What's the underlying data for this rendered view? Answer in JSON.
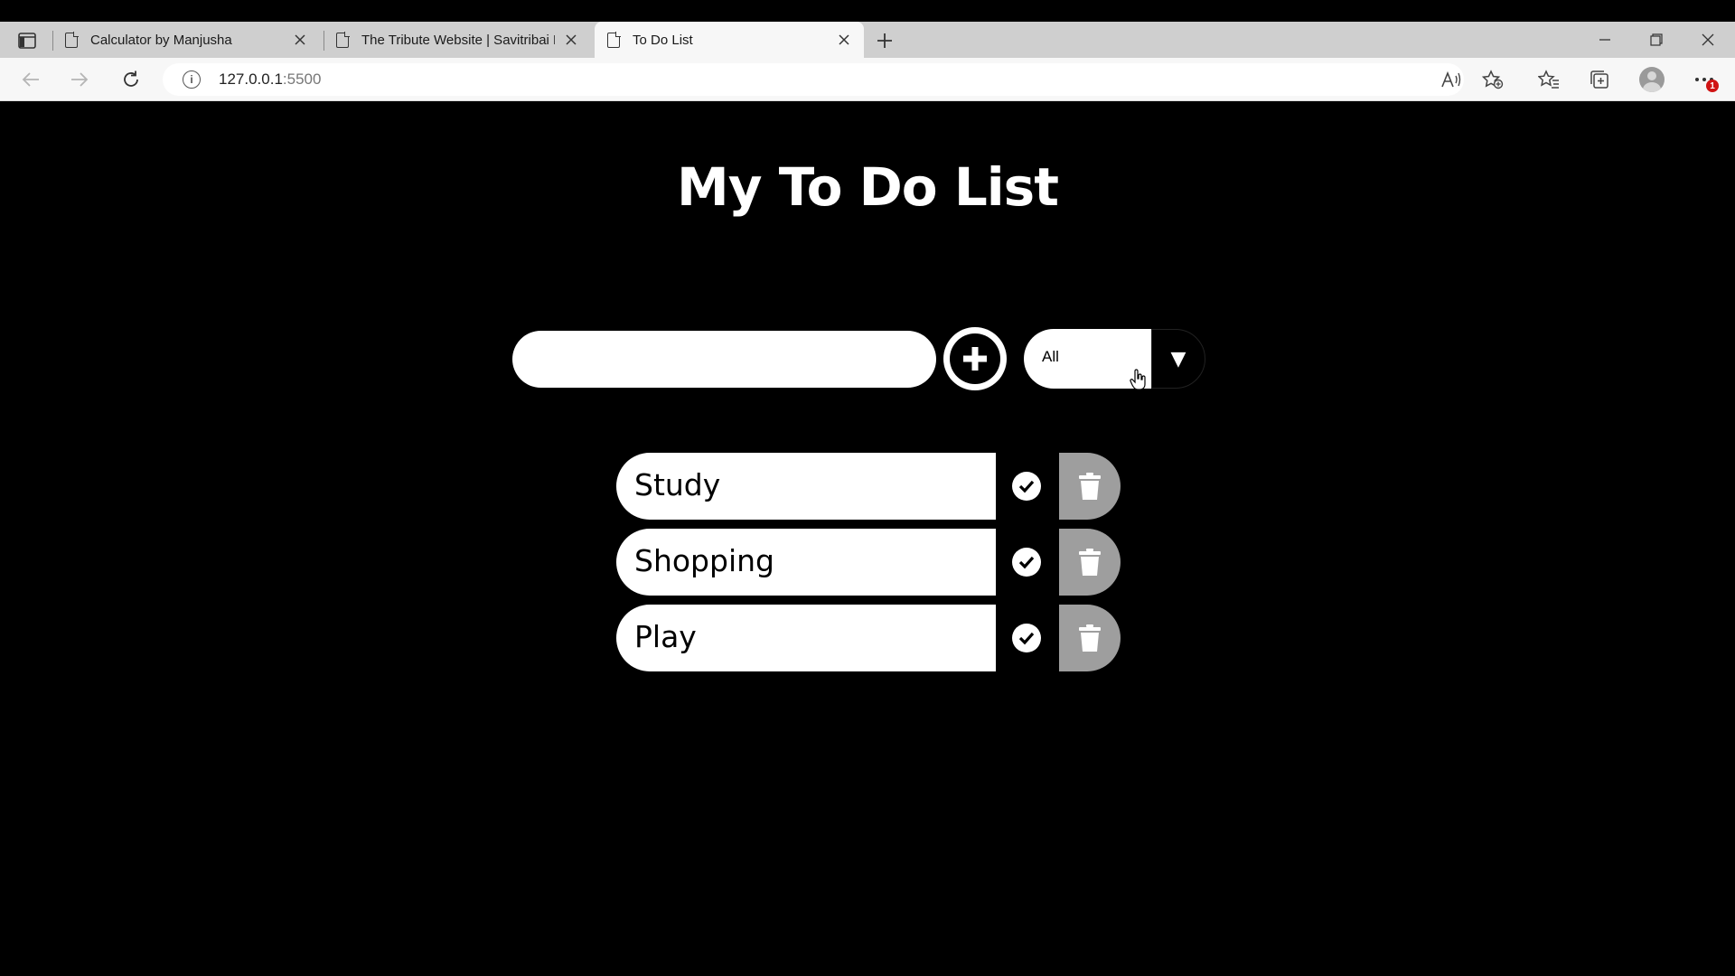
{
  "browser": {
    "tabs": [
      {
        "title": "Calculator by Manjusha",
        "active": false
      },
      {
        "title": "The Tribute Website | Savitribai P",
        "active": false
      },
      {
        "title": "To Do List",
        "active": true
      }
    ],
    "address": {
      "host": "127.0.0.1",
      "port": ":5500"
    },
    "notification_badge": "1"
  },
  "app": {
    "title": "My To Do List",
    "input": {
      "value": "",
      "placeholder": ""
    },
    "filter": {
      "selected": "All"
    },
    "todos": [
      {
        "text": "Study"
      },
      {
        "text": "Shopping"
      },
      {
        "text": "Play"
      }
    ]
  },
  "colors": {
    "page_background": "#000000",
    "delete_button": "#9e9e9e",
    "tab_bar": "#cfcfcf",
    "toolbar": "#f7f7f7"
  }
}
